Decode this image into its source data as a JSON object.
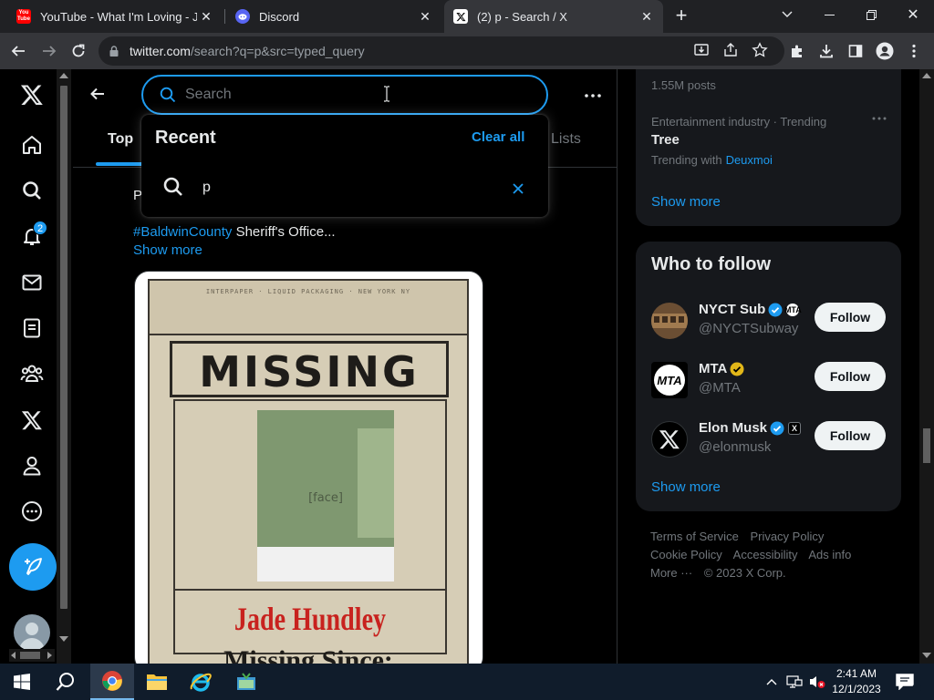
{
  "browser": {
    "tabs": [
      {
        "title": "YouTube - What I'm Loving - Jar",
        "favicon": "youtube-icon"
      },
      {
        "title": "Discord",
        "favicon": "discord-icon"
      },
      {
        "title": "(2) p - Search / X",
        "favicon": "x-icon",
        "active": true
      }
    ],
    "new_tab_symbol": "+",
    "url_host": "twitter.com",
    "url_path": "/search?q=p&src=typed_query"
  },
  "sidebar": {
    "items": [
      "x-logo-icon",
      "home-icon",
      "explore-icon",
      "notifications-icon",
      "messages-icon",
      "lists-icon",
      "communities-icon",
      "premium-x-icon",
      "profile-icon",
      "more-icon"
    ],
    "notification_count": "2"
  },
  "search": {
    "placeholder": "Search",
    "value": ""
  },
  "tabs": {
    "top": "Top",
    "lists": "Lists"
  },
  "dropdown": {
    "title": "Recent",
    "clear_all": "Clear all",
    "recent_items": [
      "p"
    ]
  },
  "post": {
    "fragment": "P",
    "hashtag": "#BaldwinCounty",
    "text": " Sheriff's Office...",
    "show_more": "Show more",
    "image": {
      "carton_stamp": "INTERPAPER · LIQUID PACKAGING · NEW YORK NY",
      "headline": "MISSING",
      "name": "Jade Hundley",
      "since": "Missing Since:"
    }
  },
  "trends": {
    "prev_count": "1.55M posts",
    "category": "Entertainment industry · Trending",
    "name": "Tree",
    "trending_with_label": "Trending with",
    "trending_with_link": "Deuxmoi",
    "show_more": "Show more"
  },
  "who_to_follow": {
    "title": "Who to follow",
    "users": [
      {
        "name": "NYCT Sub",
        "handle": "@NYCTSubway",
        "badge": "blue",
        "affiliate": "MTA",
        "button": "Follow"
      },
      {
        "name": "MTA",
        "handle": "@MTA",
        "badge": "gold",
        "button": "Follow"
      },
      {
        "name": "Elon Musk",
        "handle": "@elonmusk",
        "badge": "blue",
        "affiliate": "X",
        "button": "Follow"
      }
    ],
    "show_more": "Show more"
  },
  "footer": {
    "links": [
      "Terms of Service",
      "Privacy Policy",
      "Cookie Policy",
      "Accessibility",
      "Ads info",
      "More ···",
      "© 2023 X Corp."
    ]
  },
  "taskbar": {
    "time": "2:41 AM",
    "date": "12/1/2023"
  },
  "colors": {
    "accent": "#1d9bf0",
    "background": "#000000",
    "card": "#16181c",
    "muted": "#71767b",
    "verified_gold": "#e2b719"
  }
}
